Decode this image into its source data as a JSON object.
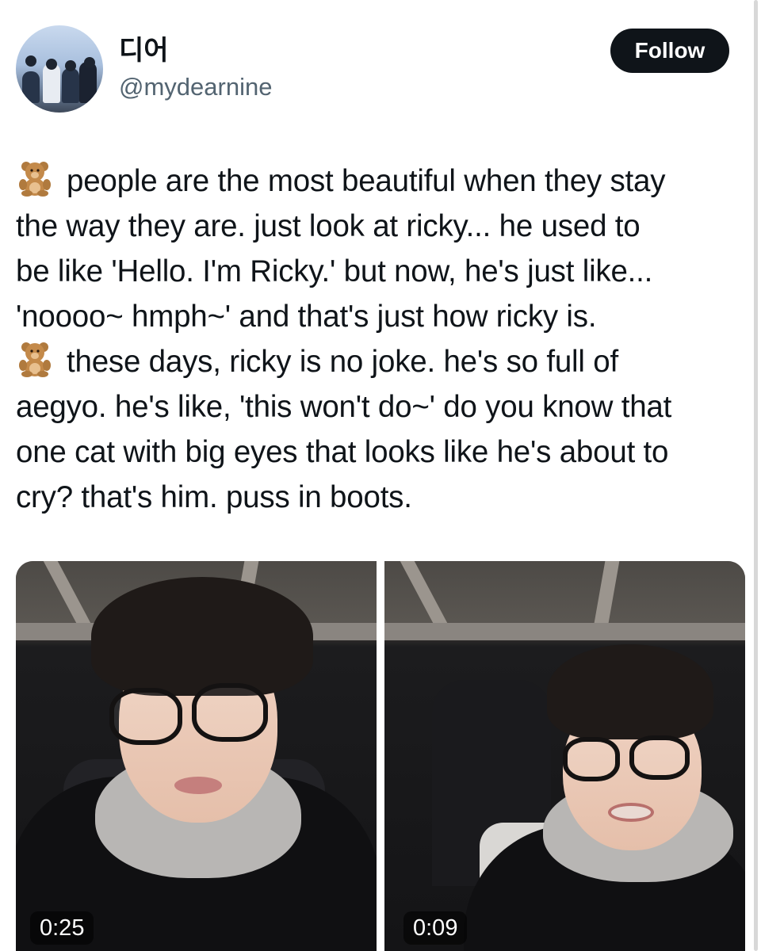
{
  "user": {
    "display_name": "디어",
    "handle": "@mydearnine",
    "avatar_icon": "avatar-photo"
  },
  "follow_button": {
    "label": "Follow"
  },
  "tweet": {
    "emoji_icon": "teddy-bear-emoji",
    "lines": [
      "people are the most beautiful when they stay",
      "the way they are. just look at ricky... he used to",
      "be like 'Hello. I'm Ricky.' but now, he's just like...",
      "'noooo~ hmph~' and that's just how ricky is.",
      "these days, ricky is no joke. he's so full of",
      "aegyo. he's like, 'this won't do~' do you know that",
      "one cat with big eyes that looks like he's about to",
      "cry? that's him. puss in boots."
    ]
  },
  "media": [
    {
      "type": "video",
      "duration": "0:25"
    },
    {
      "type": "video",
      "duration": "0:09"
    }
  ],
  "colors": {
    "text": "#0f1419",
    "secondary_text": "#536471",
    "follow_bg": "#0f1419",
    "follow_text": "#ffffff"
  }
}
